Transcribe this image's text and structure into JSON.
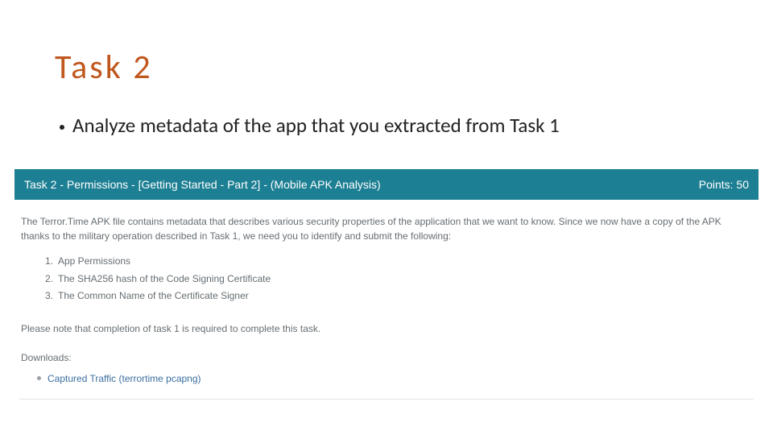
{
  "title": "Task 2",
  "bullet": "Analyze metadata of the app that you extracted from Task 1",
  "bar": {
    "title": "Task 2 - Permissions - [Getting Started - Part 2] - (Mobile APK Analysis)",
    "points_label": "Points: 50"
  },
  "description": "The Terror.Time APK file contains metadata that describes various security properties of the application that we want to know. Since we now have a copy of the APK thanks to the military operation described in Task 1, we need you to identify and submit the following:",
  "items": {
    "i1": "App Permissions",
    "i2": "The SHA256 hash of the Code Signing Certificate",
    "i3": "The Common Name of the Certificate Signer"
  },
  "note": "Please note that completion of task 1 is required to complete this task.",
  "downloads_label": "Downloads:",
  "download_link": "Captured Traffic (terrortime pcapng)"
}
